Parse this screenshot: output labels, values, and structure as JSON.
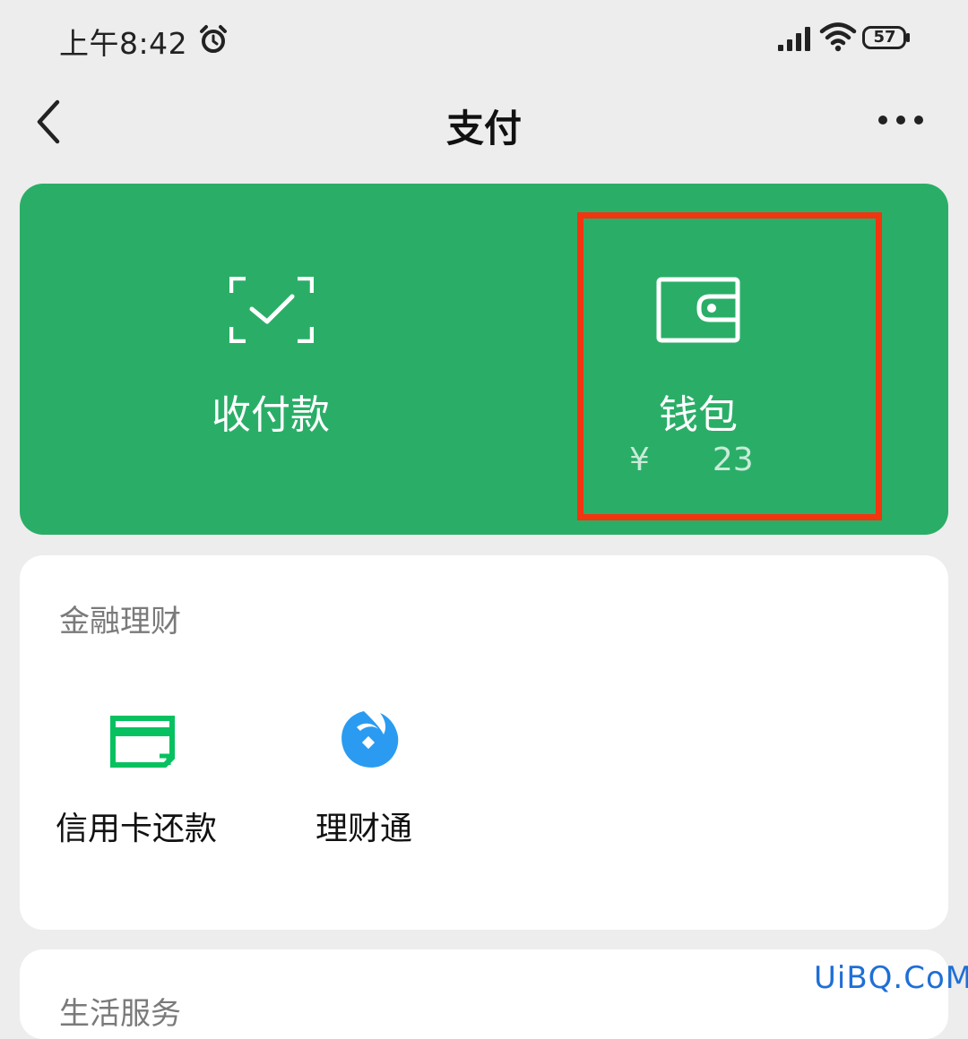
{
  "status_bar": {
    "time": "上午8:42",
    "battery": "57",
    "icons": [
      "alarm-icon",
      "signal-icon",
      "wifi-icon",
      "battery-icon"
    ]
  },
  "nav": {
    "title": "支付",
    "back_icon": "chevron-left-icon",
    "more_icon": "more-dots-icon"
  },
  "wallet_card": {
    "accent_color": "#2aae67",
    "highlight_color": "#f2340f",
    "pay_label": "收付款",
    "pay_icon": "scan-check-icon",
    "wallet_label": "钱包",
    "wallet_icon": "wallet-icon",
    "wallet_amount_start": "¥",
    "wallet_amount_end": "23"
  },
  "finance": {
    "title": "金融理财",
    "items": [
      {
        "label": "信用卡还款",
        "icon": "credit-card-icon",
        "color": "#07c160"
      },
      {
        "label": "理财通",
        "icon": "licaitong-icon",
        "color": "#2a9bf0"
      }
    ]
  },
  "life": {
    "title": "生活服务"
  },
  "watermark": "UiBQ.CoM"
}
